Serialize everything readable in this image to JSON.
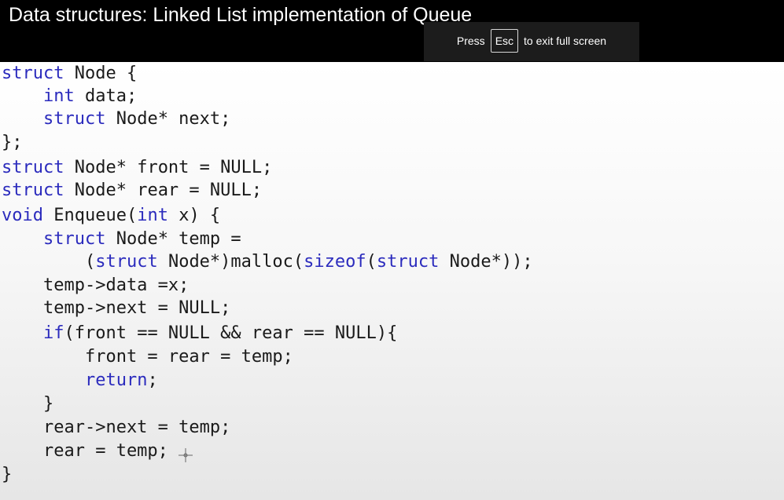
{
  "video": {
    "title": "Data structures: Linked List implementation of Queue"
  },
  "fullscreen_hint": {
    "press": "Press",
    "key": "Esc",
    "rest": "to exit full screen"
  },
  "code": {
    "lines": [
      [
        {
          "t": "struct",
          "k": true
        },
        {
          "t": " Node {"
        }
      ],
      [
        {
          "t": "    "
        },
        {
          "t": "int",
          "k": true
        },
        {
          "t": " data;"
        }
      ],
      [
        {
          "t": "    "
        },
        {
          "t": "struct",
          "k": true
        },
        {
          "t": " Node* next;"
        }
      ],
      [
        {
          "t": "};"
        }
      ],
      [
        {
          "t": "struct",
          "k": true
        },
        {
          "t": " Node* front = NULL;"
        }
      ],
      [
        {
          "t": "struct",
          "k": true
        },
        {
          "t": " Node* rear = NULL;"
        }
      ],
      [
        {
          "t": "void",
          "k": true
        },
        {
          "t": " Enqueue("
        },
        {
          "t": "int",
          "k": true
        },
        {
          "t": " x) {"
        }
      ],
      [
        {
          "t": "    "
        },
        {
          "t": "struct",
          "k": true
        },
        {
          "t": " Node* temp ="
        }
      ],
      [
        {
          "t": "        ("
        },
        {
          "t": "struct",
          "k": true
        },
        {
          "t": " Node*)malloc("
        },
        {
          "t": "sizeof",
          "k": true
        },
        {
          "t": "("
        },
        {
          "t": "struct",
          "k": true
        },
        {
          "t": " Node*));"
        }
      ],
      [
        {
          "t": "    temp->data =x;"
        }
      ],
      [
        {
          "t": "    temp->next = NULL;"
        }
      ],
      [
        {
          "t": "    "
        },
        {
          "t": "if",
          "k": true
        },
        {
          "t": "(front == NULL && rear == NULL){"
        }
      ],
      [
        {
          "t": "        front = rear = temp;"
        }
      ],
      [
        {
          "t": "        "
        },
        {
          "t": "return",
          "k": true
        },
        {
          "t": ";"
        }
      ],
      [
        {
          "t": "    }"
        }
      ],
      [
        {
          "t": "    rear->next = temp;"
        }
      ],
      [
        {
          "t": "    rear = temp;"
        }
      ],
      [
        {
          "t": "}"
        }
      ]
    ]
  },
  "colors": {
    "keyword": "#2b2bbd",
    "text": "#1a1a1a",
    "title_bar": "#000000",
    "hint_bg": "#1c1c1c"
  },
  "icons": {
    "cursor": "crosshair-cursor-icon"
  }
}
